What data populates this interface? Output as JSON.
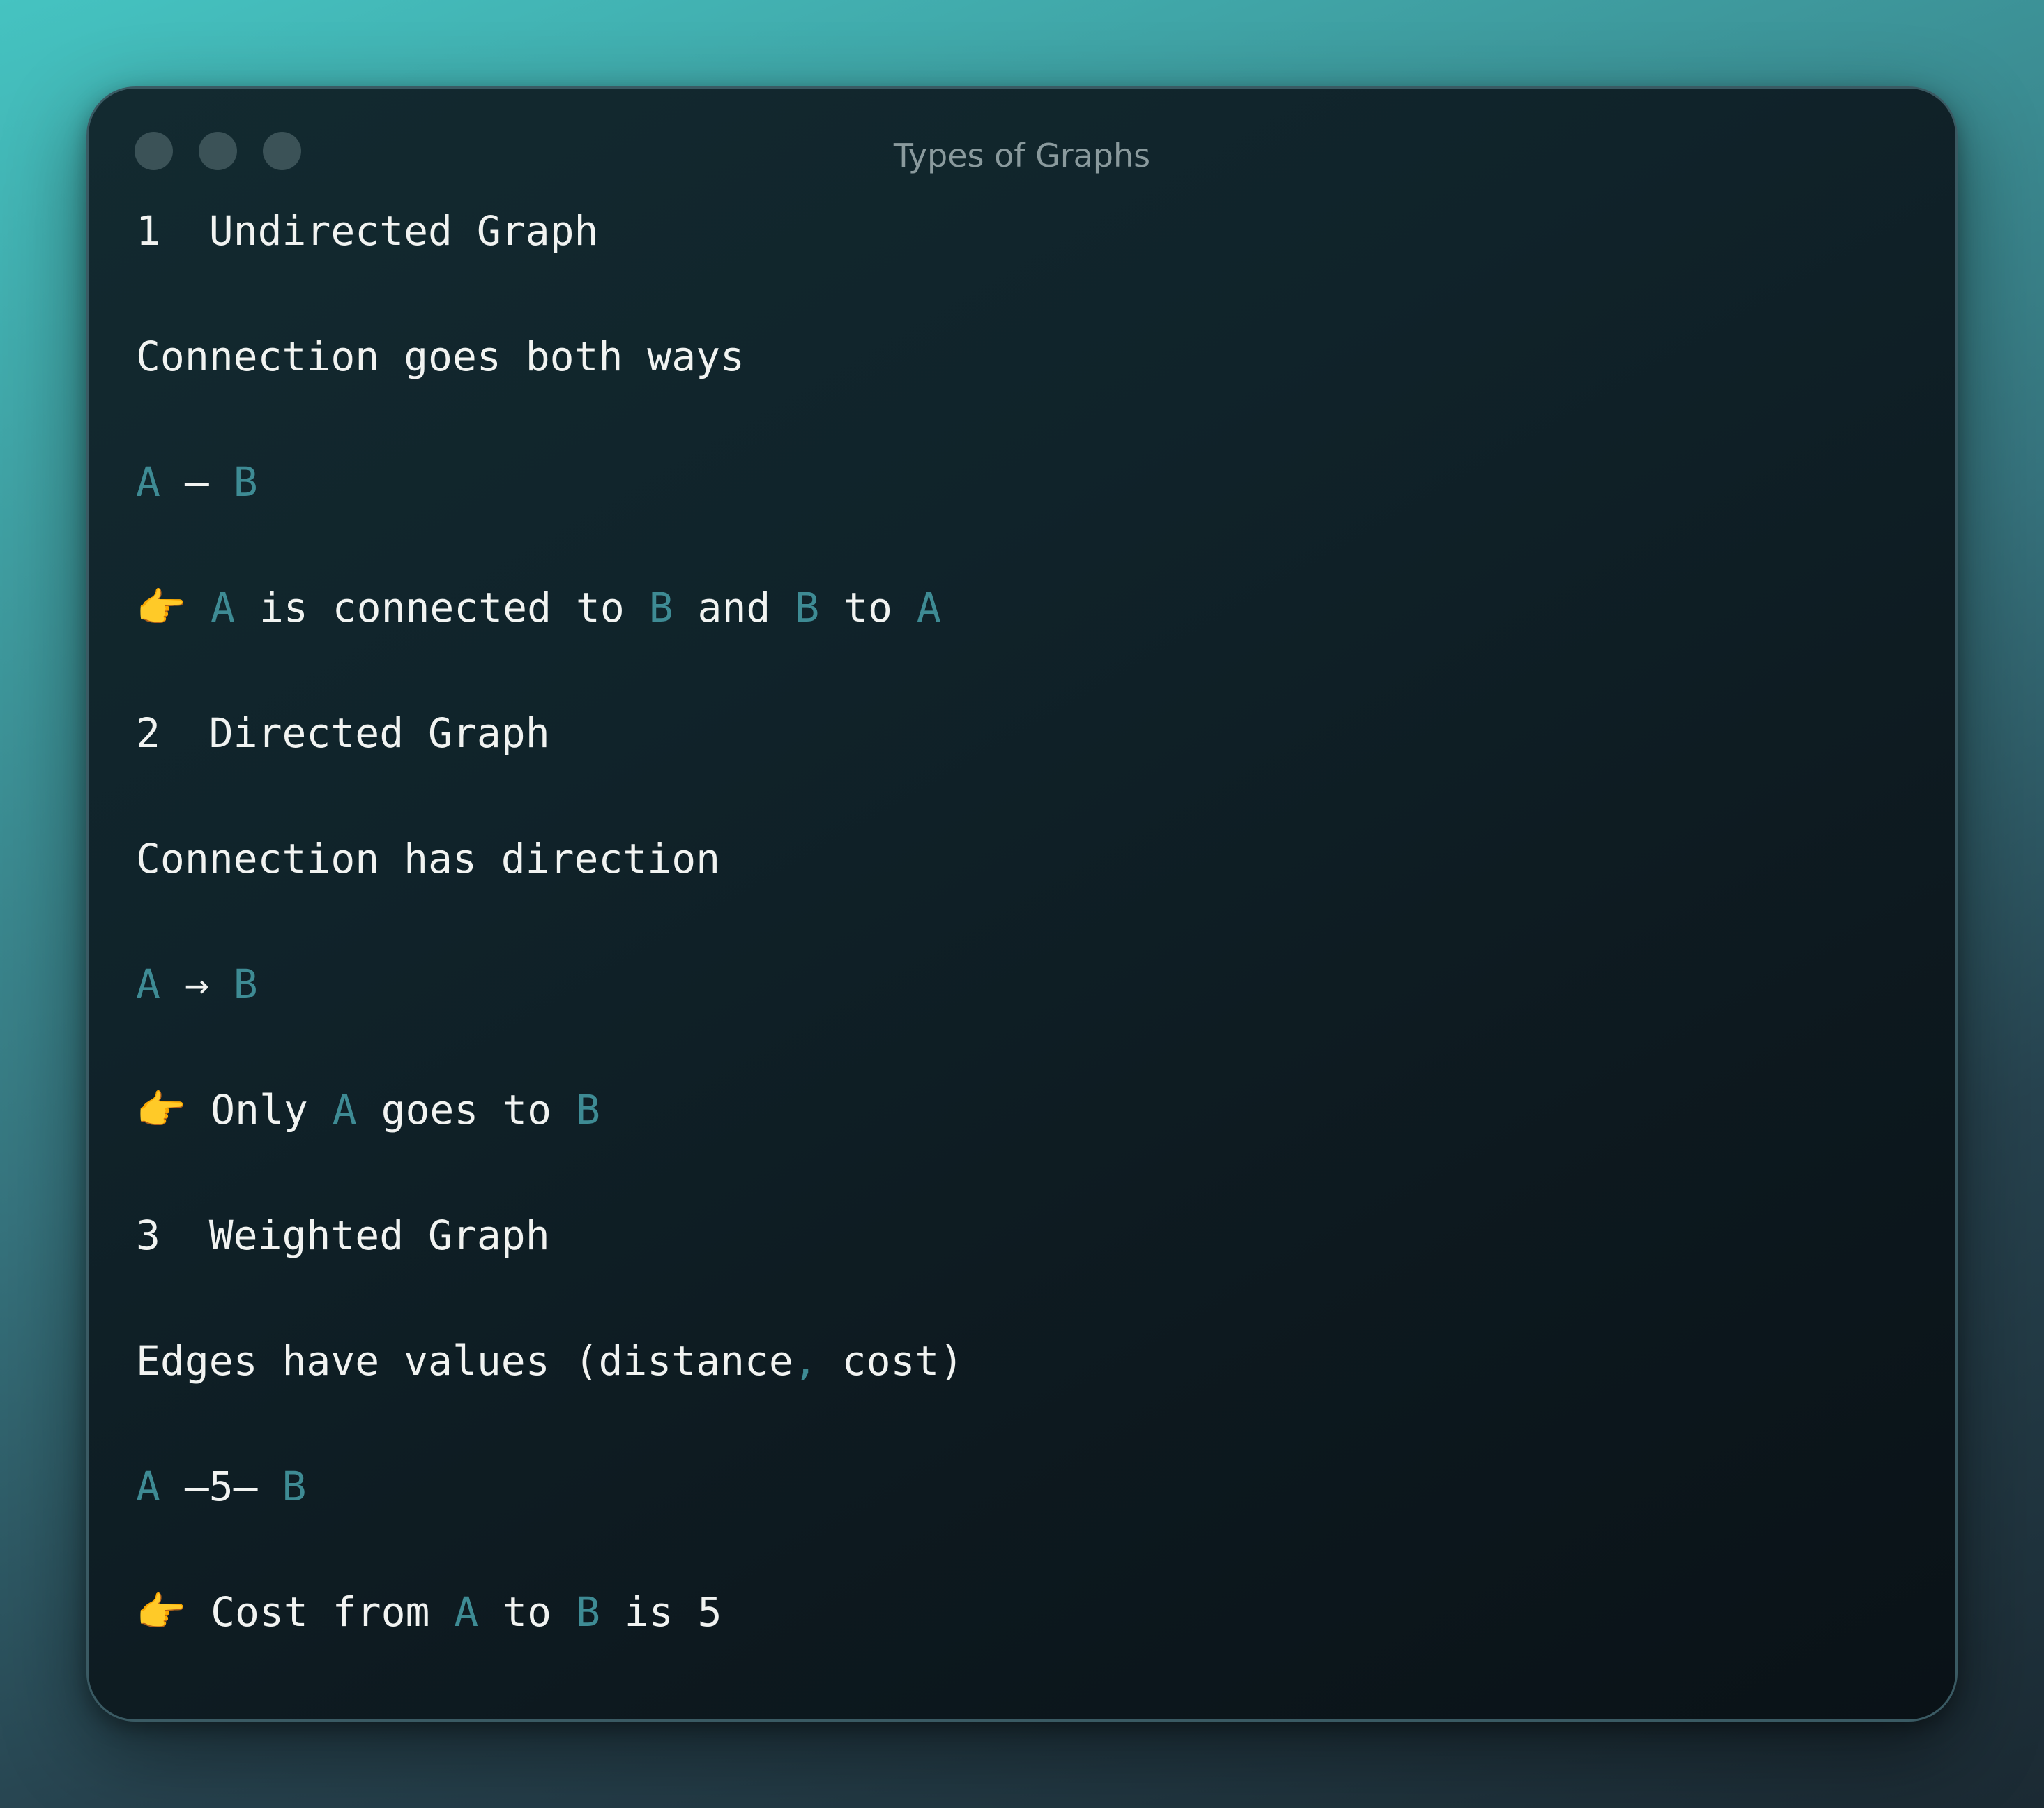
{
  "window": {
    "title": "Types of Graphs",
    "controls": [
      "close",
      "minimize",
      "maximize"
    ]
  },
  "colors": {
    "text": "#f1f3f1",
    "accent": "#3e8b94",
    "title": "#8a9a9d",
    "window_bg": "#10232a"
  },
  "lines": [
    [
      {
        "t": "1  Undirected Graph"
      }
    ],
    [
      {
        "t": "Connection goes both ways"
      }
    ],
    [
      {
        "t": "A",
        "accent": true
      },
      {
        "t": " — "
      },
      {
        "t": "B",
        "accent": true
      }
    ],
    [
      {
        "t": "👉",
        "emoji": true
      },
      {
        "t": " "
      },
      {
        "t": "A",
        "accent": true
      },
      {
        "t": " is connected to "
      },
      {
        "t": "B",
        "accent": true
      },
      {
        "t": " and "
      },
      {
        "t": "B",
        "accent": true
      },
      {
        "t": " to "
      },
      {
        "t": "A",
        "accent": true
      }
    ],
    [
      {
        "t": "2  Directed Graph"
      }
    ],
    [
      {
        "t": "Connection has direction"
      }
    ],
    [
      {
        "t": "A",
        "accent": true
      },
      {
        "t": " → "
      },
      {
        "t": "B",
        "accent": true
      }
    ],
    [
      {
        "t": "👉",
        "emoji": true
      },
      {
        "t": " Only "
      },
      {
        "t": "A",
        "accent": true
      },
      {
        "t": " goes to "
      },
      {
        "t": "B",
        "accent": true
      }
    ],
    [
      {
        "t": "3  Weighted Graph"
      }
    ],
    [
      {
        "t": "Edges have values (distance"
      },
      {
        "t": ",",
        "accent": true
      },
      {
        "t": " cost)"
      }
    ],
    [
      {
        "t": "A",
        "accent": true
      },
      {
        "t": " —5— "
      },
      {
        "t": "B",
        "accent": true
      }
    ],
    [
      {
        "t": "👉",
        "emoji": true
      },
      {
        "t": " Cost from "
      },
      {
        "t": "A",
        "accent": true
      },
      {
        "t": " to "
      },
      {
        "t": "B",
        "accent": true
      },
      {
        "t": " is 5"
      }
    ]
  ]
}
